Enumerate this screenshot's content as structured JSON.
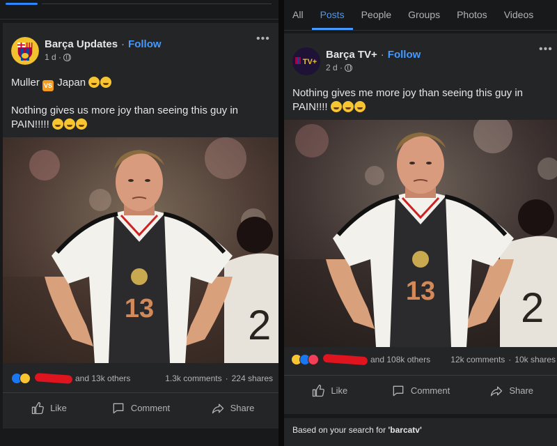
{
  "left_post": {
    "page_name": "Barça Updates",
    "separator": "·",
    "follow": "Follow",
    "time": "1 d ·",
    "line1_prefix": "Muller",
    "line1_vs": "VS",
    "line1_suffix": "Japan",
    "body": "Nothing gives us more joy than seeing this guy in PAIN!!!!!",
    "jersey_number": "13",
    "reactions_text": "and 13k others",
    "comments": "1.3k comments",
    "dot": "·",
    "shares": "224 shares",
    "actions": [
      "Like",
      "Comment",
      "Share"
    ]
  },
  "right_tabs": [
    "All",
    "Posts",
    "People",
    "Groups",
    "Photos",
    "Videos"
  ],
  "right_post": {
    "page_name": "Barça TV+",
    "avatar_text": "TV+",
    "separator": "·",
    "follow": "Follow",
    "time": "2 d ·",
    "body": "Nothing gives me more joy than seeing this guy in PAIN!!!!",
    "jersey_number": "13",
    "reactions_text": "and 108k others",
    "comments": "12k comments",
    "dot": "·",
    "shares": "10k shares",
    "actions": [
      "Like",
      "Comment",
      "Share"
    ]
  },
  "search_note_prefix": "Based on your search for",
  "search_note_query": "'barcatv'",
  "colors": {
    "background": "#18191a",
    "card": "#242526",
    "accent": "#4599ff",
    "text": "#e4e6eb",
    "secondary_text": "#b0b3b8",
    "redaction": "#e0141e"
  },
  "icons": [
    "barca-crest-icon",
    "globe-icon",
    "more-options-icon",
    "like-icon",
    "comment-icon",
    "share-icon",
    "like-reaction-icon",
    "haha-reaction-icon",
    "love-reaction-icon"
  ]
}
